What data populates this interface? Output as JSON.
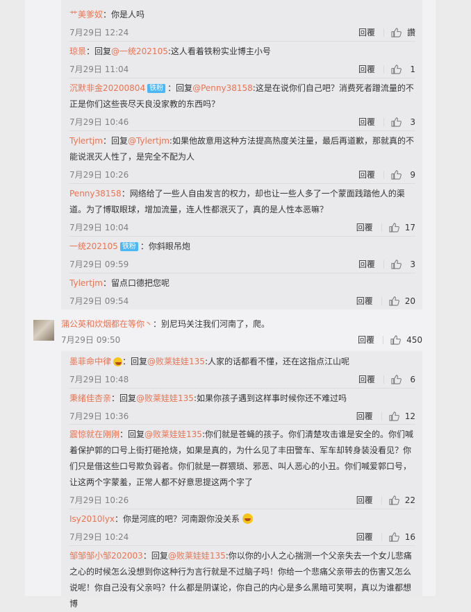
{
  "ui": {
    "reply_label": "回覆"
  },
  "replies_a": [
    {
      "name": "艹美爹奴",
      "badge": "",
      "prefix": "",
      "mention": "",
      "text": "：你是人吗",
      "time": "7月29日 12:24",
      "likes": "讚"
    },
    {
      "name": "琼景",
      "badge": "",
      "prefix": "：回复",
      "mention": "@一统202105",
      "text": ":这人看着铁粉实业博主小号",
      "time": "7月29日 11:04",
      "likes": "1"
    },
    {
      "name": "沉默非金20200804",
      "badge": "铁粉",
      "prefix": "：回复",
      "mention": "@Penny38158",
      "text": ":这是在说你们自己吧？消费死者蹭流量的不正是你们这些丧尽天良没家教的东西吗？",
      "time": "7月29日 10:46",
      "likes": "3"
    },
    {
      "name": "Tylertjm",
      "badge": "",
      "prefix": "：回复",
      "mention": "@Tylertjm",
      "text": ":如果他故意用这种方法提高热度关注量，最后再道歉，那就真的不能说泯灭人性了，是完全不配为人",
      "time": "7月29日 10:26",
      "likes": "9"
    },
    {
      "name": "Penny38158",
      "badge": "",
      "prefix": "",
      "mention": "",
      "text": "：网络给了一些人自由发言的权力，却也让一些人多了一个蒙面践踏他人的渠道。为了博取眼球，增加流量，连人性都泯灭了，真的是人性本恶嘛？",
      "time": "7月29日 10:04",
      "likes": "17"
    },
    {
      "name": "一统202105",
      "badge": "铁粉",
      "prefix": "",
      "mention": "",
      "text": "：你斜眼吊炮",
      "time": "7月29日 09:59",
      "likes": "3"
    },
    {
      "name": "Tylertjm",
      "badge": "",
      "prefix": "",
      "mention": "",
      "text": "：留点口德把您呢",
      "time": "7月29日 09:54",
      "likes": "20"
    }
  ],
  "top_comment": {
    "name": "蒲公英和炊烟都在等你丶",
    "text": "：别尼玛关注我们河南了，爬。",
    "time": "7月29日 09:50",
    "likes": "450"
  },
  "replies_b": [
    {
      "name": "墨菲命中律",
      "badge": "",
      "prefix": "：回复",
      "mention": "@败莱娃娃135",
      "text": ":人家的话都看不懂，还在这指点江山呢",
      "time": "7月29日 10:48",
      "likes": "6"
    },
    {
      "name": "秉绪佳杏亲",
      "badge": "",
      "prefix": "：回复",
      "mention": "@败莱娃娃135",
      "text": ":如果你孩子遇到这样事时候你还不难过吗",
      "time": "7月29日 10:36",
      "likes": "12"
    },
    {
      "name": "震惊就在刚刚",
      "badge": "",
      "prefix": "：回复",
      "mention": "@败莱娃娃135",
      "text": ":你们就是苍蝇的孩子。你们清楚攻击谁是安全的。你们喊着保护郭的口号上街打砸抢烧，如果是真的，为什么见了丰田警车、军车却转身装没看见？你们只是借这些口号欺负弱者。你们就是一群猥琐、邪恶、叫人恶心的小丑。你们喊爱郭口号，让这两个字蒙羞，正常人都不好意思提这两个字了",
      "time": "7月29日 10:26",
      "likes": "22"
    },
    {
      "name": "Isy2010lyx",
      "badge": "",
      "prefix": "",
      "mention": "",
      "text": "：你是河底的吧？河南跟你没关系",
      "time": "7月29日 10:24",
      "likes": "16"
    },
    {
      "name": "邹邹邹小邹202003",
      "badge": "",
      "prefix": "：回复",
      "mention": "@败莱娃娃135",
      "text": ":你以你的小人之心揣测一个父亲失去一个女儿悲痛之心的时候怎么没想到你这种行为言行就是不过脑子吗！你给一个悲痛父亲带去的伤害又怎么说呢！你自己没有父亲吗？什么都是阴谋论，你自己的内心是多么黑暗可笑啊，真以为谁都想博",
      "time": "",
      "likes": ""
    }
  ]
}
